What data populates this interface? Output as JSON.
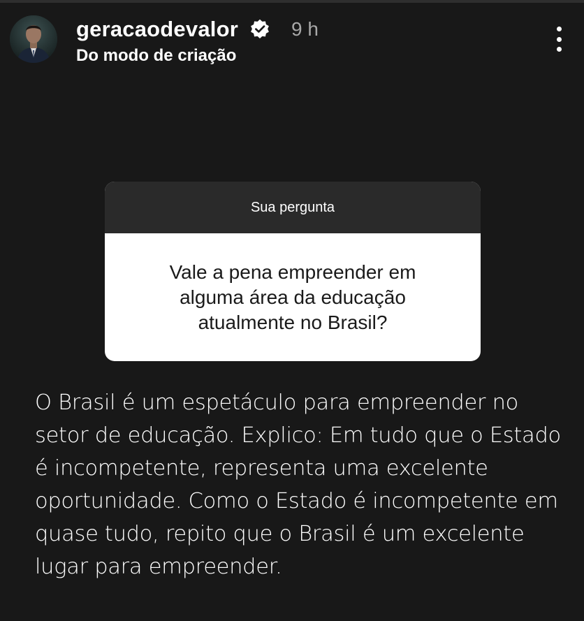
{
  "story": {
    "progress": 0.0
  },
  "header": {
    "username": "geracaodevalor",
    "verified": true,
    "timestamp": "9 h",
    "subtitle": "Do modo de criação",
    "more_icon": "more-vertical-icon"
  },
  "question_card": {
    "title": "Sua pergunta",
    "question": "Vale a pena empreender em alguma área da educação atualmente no Brasil?"
  },
  "answer": {
    "text": "O Brasil é um espetáculo para empreender no setor de educação. Explico: Em tudo que o Estado é incompetente, representa uma excelente oportunidade. Como o Estado é incompetente em quase tudo, repito que o Brasil é um excelente lugar para empreender."
  },
  "colors": {
    "background": "#181818",
    "card_header": "#2a2a2a",
    "card_body": "#ffffff",
    "text_primary": "#ffffff",
    "text_secondary": "#a8a8a8"
  }
}
